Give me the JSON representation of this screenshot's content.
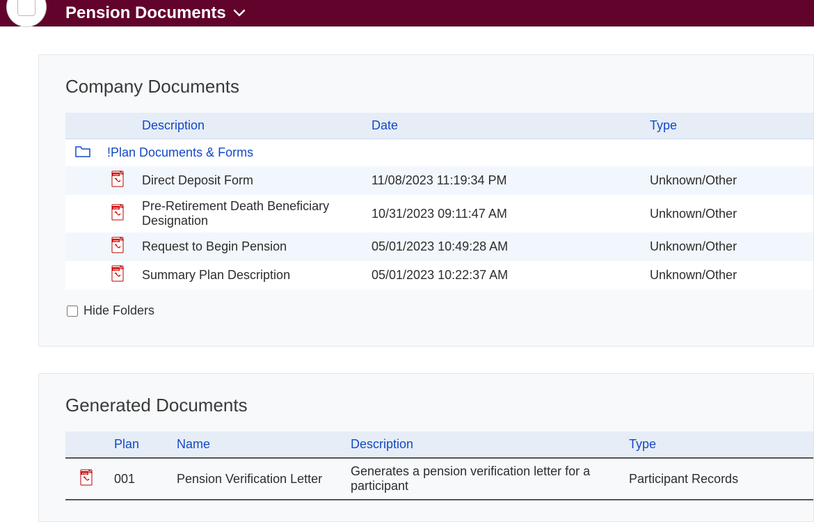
{
  "header": {
    "page_title": "Pension Documents"
  },
  "company": {
    "heading": "Company Documents",
    "columns": {
      "description": "Description",
      "date": "Date",
      "type": "Type"
    },
    "folder_label": "!Plan Documents & Forms",
    "rows": [
      {
        "description": "Direct Deposit Form",
        "date": "11/08/2023 11:19:34 PM",
        "type": "Unknown/Other"
      },
      {
        "description": "Pre-Retirement Death Beneficiary Designation",
        "date": "10/31/2023 09:11:47 AM",
        "type": "Unknown/Other"
      },
      {
        "description": "Request to Begin Pension",
        "date": "05/01/2023 10:49:28 AM",
        "type": "Unknown/Other"
      },
      {
        "description": "Summary Plan Description",
        "date": "05/01/2023 10:22:37 AM",
        "type": "Unknown/Other"
      }
    ],
    "hide_folders_label": "Hide Folders"
  },
  "generated": {
    "heading": "Generated Documents",
    "columns": {
      "plan": "Plan",
      "name": "Name",
      "description": "Description",
      "type": "Type"
    },
    "rows": [
      {
        "plan": "001",
        "name": "Pension Verification Letter",
        "description": "Generates a pension verification letter for a participant",
        "type": "Participant Records"
      }
    ]
  }
}
